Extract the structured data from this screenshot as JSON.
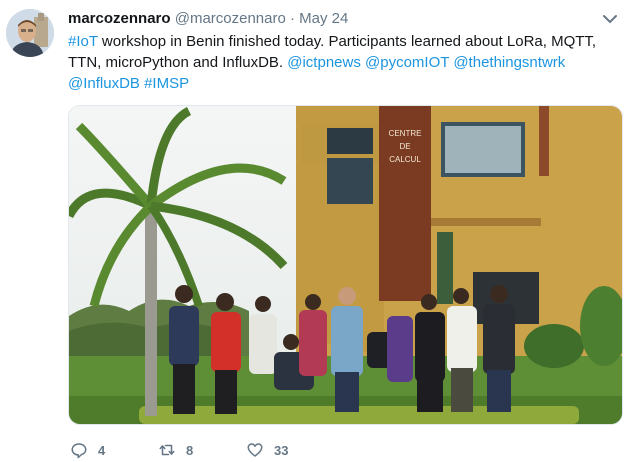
{
  "tweet": {
    "name": "marcozennaro",
    "handle": "@marcozennaro",
    "separator": "·",
    "date": "May 24",
    "text_parts": [
      {
        "text": "#IoT",
        "link": true
      },
      {
        "text": " workshop in Benin finished today. Participants learned about LoRa, MQTT, TTN, microPython and InfluxDB. ",
        "link": false
      },
      {
        "text": "@ictpnews",
        "link": true
      },
      {
        "text": " ",
        "link": false
      },
      {
        "text": "@pycomIOT",
        "link": true
      },
      {
        "text": " ",
        "link": false
      },
      {
        "text": "@thethingsntwrk",
        "link": true
      },
      {
        "text": " ",
        "link": false
      },
      {
        "text": "@InfluxDB",
        "link": true
      },
      {
        "text": " ",
        "link": false
      },
      {
        "text": "#IMSP",
        "link": true
      }
    ],
    "photo": {
      "building_sign": [
        "CENTRE",
        "DE",
        "CALCUL"
      ]
    },
    "actions": {
      "replies": "4",
      "retweets": "8",
      "likes": "33"
    }
  },
  "colors": {
    "link": "#1b95e0",
    "secondary": "#657786",
    "text": "#14171a"
  },
  "icons": [
    "caret-down-icon",
    "reply-icon",
    "retweet-icon",
    "like-icon"
  ]
}
